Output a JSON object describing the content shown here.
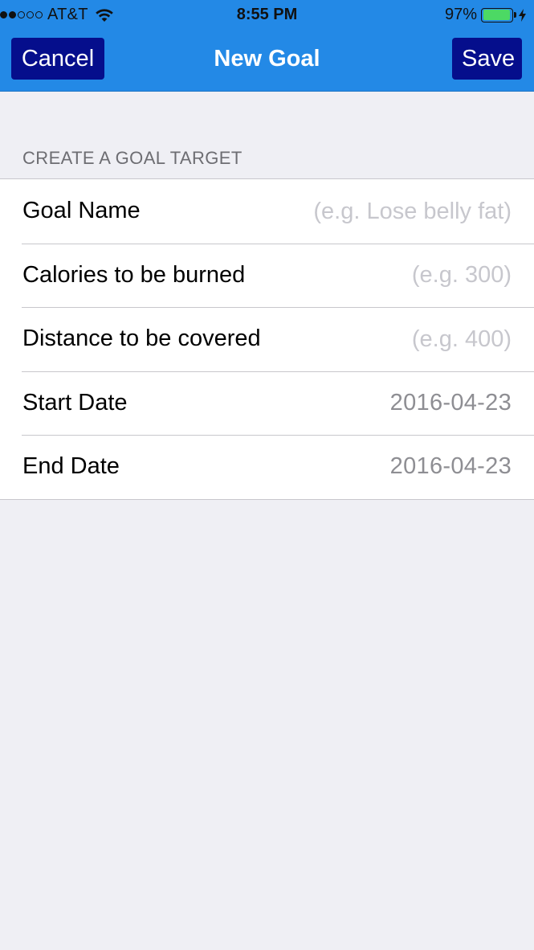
{
  "status_bar": {
    "carrier": "AT&T",
    "time": "8:55 PM",
    "battery_percent": "97%",
    "battery_level": 0.97,
    "signal_bars": 2,
    "signal_total": 5
  },
  "nav": {
    "title": "New Goal",
    "cancel_label": "Cancel",
    "save_label": "Save"
  },
  "form": {
    "section_header": "CREATE A GOAL TARGET",
    "goal_name": {
      "label": "Goal Name",
      "value": "",
      "placeholder": "(e.g. Lose belly fat)"
    },
    "calories": {
      "label": "Calories to be burned",
      "value": "",
      "placeholder": "(e.g. 300)"
    },
    "distance": {
      "label": "Distance to be covered",
      "value": "",
      "placeholder": "(e.g. 400)"
    },
    "start_date": {
      "label": "Start Date",
      "value": "2016-04-23"
    },
    "end_date": {
      "label": "End Date",
      "value": "2016-04-23"
    }
  },
  "colors": {
    "nav_background": "#2389e6",
    "button_background": "#050e8c",
    "battery_fill": "#4cd964"
  }
}
